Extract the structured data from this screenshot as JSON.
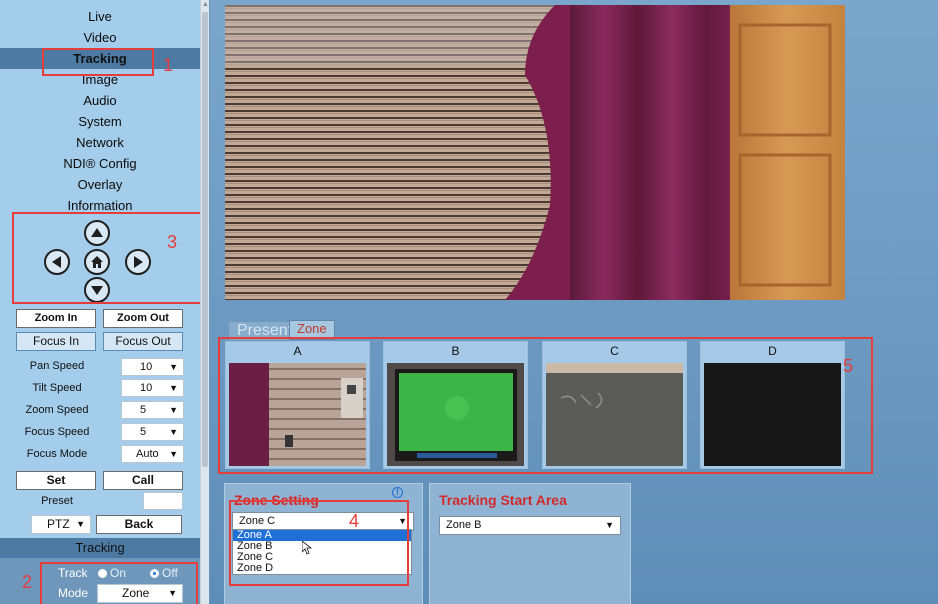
{
  "nav": {
    "items": [
      {
        "label": "Live"
      },
      {
        "label": "Video"
      },
      {
        "label": "Tracking"
      },
      {
        "label": "Image"
      },
      {
        "label": "Audio"
      },
      {
        "label": "System"
      },
      {
        "label": "Network"
      },
      {
        "label": "NDI® Config"
      },
      {
        "label": "Overlay"
      },
      {
        "label": "Information"
      }
    ],
    "active": "Tracking"
  },
  "annotations": [
    "1",
    "2",
    "3",
    "4",
    "5"
  ],
  "ptz": {
    "zoom_in": "Zoom In",
    "zoom_out": "Zoom Out",
    "focus_in": "Focus In",
    "focus_out": "Focus Out",
    "settings": [
      {
        "label": "Pan Speed",
        "value": "10"
      },
      {
        "label": "Tilt Speed",
        "value": "10"
      },
      {
        "label": "Zoom Speed",
        "value": "5"
      },
      {
        "label": "Focus Speed",
        "value": "5"
      },
      {
        "label": "Focus Mode",
        "value": "Auto"
      }
    ],
    "set": "Set",
    "call": "Call",
    "preset_label": "Preset",
    "preset_value": "",
    "mode_select": "PTZ",
    "back": "Back"
  },
  "tracking": {
    "header": "Tracking",
    "track_label": "Track",
    "on_label": "On",
    "off_label": "Off",
    "track_value": "Off",
    "mode_label": "Mode",
    "mode_value": "Zone"
  },
  "tabs": [
    {
      "label": "Presenter",
      "active": false
    },
    {
      "label": "Zone",
      "active": true
    }
  ],
  "zones": [
    {
      "label": "A"
    },
    {
      "label": "B"
    },
    {
      "label": "C"
    },
    {
      "label": "D"
    }
  ],
  "zone_setting": {
    "title": "Zone Setting",
    "info_icon": "info-icon",
    "selected": "Zone C",
    "options": [
      "Zone A",
      "Zone B",
      "Zone C",
      "Zone D"
    ],
    "highlighted": "Zone A"
  },
  "tracking_start": {
    "title": "Tracking Start Area",
    "selected": "Zone B"
  },
  "colors": {
    "sidebar": "#a3cdea",
    "active_nav": "#4d7aa3",
    "annotation_red": "#e53c3c",
    "panel_title_red": "#d02a2a"
  }
}
